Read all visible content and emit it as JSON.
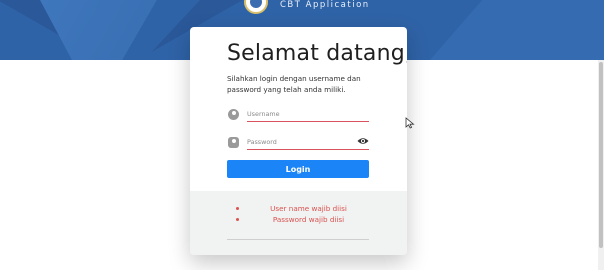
{
  "header": {
    "app_title": "CBT Application",
    "logo_icon": "school-emblem-icon",
    "colors": {
      "banner": "#2f63a7"
    }
  },
  "login": {
    "heading": "Selamat datang,",
    "subtitle": "Silahkan login dengan username dan password yang telah anda miliki.",
    "username": {
      "placeholder": "Username",
      "value": "",
      "icon": "user-icon"
    },
    "password": {
      "placeholder": "Password",
      "value": "",
      "icon": "lock-icon",
      "toggle_icon": "eye-icon"
    },
    "submit_label": "Login",
    "colors": {
      "button": "#1b84f6",
      "error": "#d9534f"
    }
  },
  "errors": [
    "User name wajib diisi",
    "Password wajib diisi"
  ]
}
